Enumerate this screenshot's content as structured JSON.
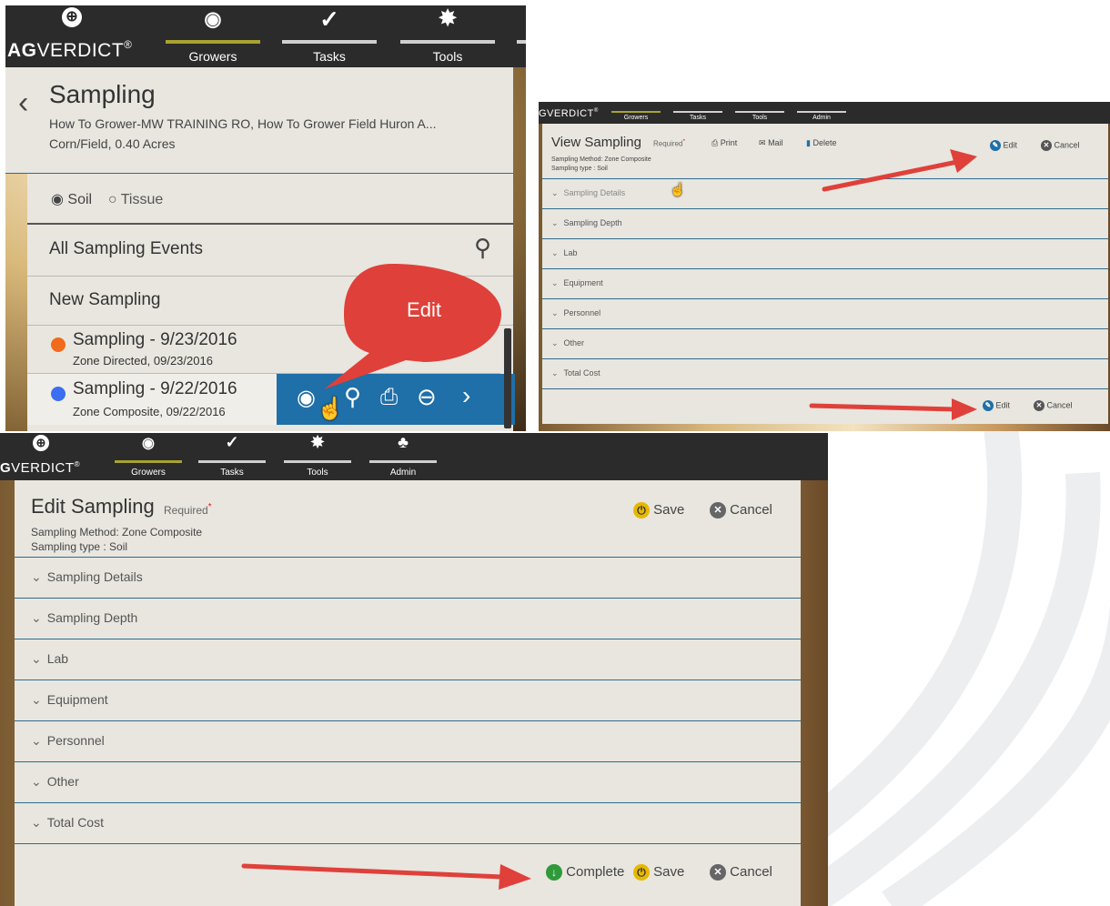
{
  "brand": {
    "name_bold": "AG",
    "name_rest": "VERDICT",
    "reg": "®"
  },
  "nav": {
    "growers": "Growers",
    "tasks": "Tasks",
    "tools": "Tools",
    "admin": "Admin"
  },
  "shot1": {
    "title": "Sampling",
    "subtitle1": "How To Grower-MW TRAINING RO, How To Grower Field Huron A...",
    "subtitle2": "Corn/Field, 0.40 Acres",
    "radio_soil": "Soil",
    "radio_tissue": "Tissue",
    "all_events": "All Sampling Events",
    "new_sampling": "New Sampling",
    "callout": "Edit",
    "events": [
      {
        "title": "Sampling - 9/23/2016",
        "sub": "Zone Directed, 09/23/2016",
        "dot": "#f26a1b"
      },
      {
        "title": "Sampling - 9/22/2016",
        "sub": "Zone Composite, 09/22/2016",
        "dot": "#3b6ef0"
      }
    ],
    "colors": {
      "action_bar": "#1f6fa8",
      "callout": "#e0403a"
    }
  },
  "shot2": {
    "title": "View Sampling",
    "required": "Required",
    "method": "Sampling Method: Zone Composite",
    "type": "Sampling type : Soil",
    "print": "Print",
    "mail": "Mail",
    "delete": "Delete",
    "edit": "Edit",
    "cancel": "Cancel",
    "sections": [
      "Sampling Details",
      "Sampling Depth",
      "Lab",
      "Equipment",
      "Personnel",
      "Other",
      "Total Cost"
    ]
  },
  "shot3": {
    "title": "Edit Sampling",
    "required": "Required",
    "method": "Sampling Method: Zone Composite",
    "type": "Sampling type : Soil",
    "save": "Save",
    "cancel": "Cancel",
    "complete": "Complete",
    "sections": [
      "Sampling Details",
      "Sampling Depth",
      "Lab",
      "Equipment",
      "Personnel",
      "Other",
      "Total Cost"
    ]
  },
  "icons": {
    "edit": "pencil-circle-icon",
    "cancel": "x-circle-icon",
    "save": "power-circle-icon",
    "complete": "down-arrow-circle-icon"
  },
  "colors": {
    "arrow": "#e0403a",
    "divider": "#2e6c8f",
    "nav_active": "#a9a331"
  }
}
